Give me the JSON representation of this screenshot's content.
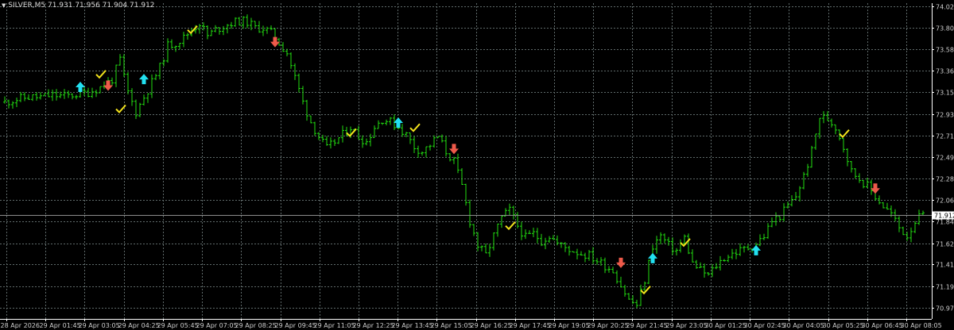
{
  "window": {
    "header_text": "SILVER,M5  71.931 71.956 71.904 71.912",
    "symbol": "SILVER,M5",
    "ohlc": [
      "71.931",
      "71.956",
      "71.904",
      "71.912"
    ]
  },
  "colors": {
    "background": "#000000",
    "grid": "#5f6a6a",
    "candle": "#22dd11",
    "axis": "#ffffff",
    "buy_arrow": "#22e0f0",
    "sell_arrow": "#ee5a4a",
    "check_mark": "#f2e21c",
    "current_price_box": "#ffffff",
    "current_price_line": "#8c8c8c"
  },
  "chart_data": {
    "type": "candlestick",
    "symbol": "SILVER",
    "timeframe": "M5",
    "ylim": [
      70.86,
      74.05
    ],
    "price_ticks": [
      "74.020",
      "73.800",
      "73.585",
      "73.365",
      "73.150",
      "72.930",
      "72.710",
      "72.495",
      "72.280",
      "72.060",
      "71.845",
      "71.625",
      "71.410",
      "71.190",
      "70.975"
    ],
    "current_price": "71.912",
    "time_ticks": [
      "28 Apr 2026",
      "29 Apr 01:45",
      "29 Apr 03:05",
      "29 Apr 04:25",
      "29 Apr 05:45",
      "29 Apr 07:05",
      "29 Apr 08:25",
      "29 Apr 09:45",
      "29 Apr 11:05",
      "29 Apr 12:25",
      "29 Apr 13:45",
      "29 Apr 15:05",
      "29 Apr 16:25",
      "29 Apr 17:45",
      "29 Apr 19:05",
      "29 Apr 20:25",
      "29 Apr 21:45",
      "29 Apr 23:05",
      "30 Apr 01:25",
      "30 Apr 02:45",
      "30 Apr 04:05",
      "30 Apr 05:25",
      "30 Apr 06:45",
      "30 Apr 08:05"
    ],
    "close_path": [
      [
        0,
        73.05
      ],
      [
        3,
        73.08
      ],
      [
        6,
        73.1
      ],
      [
        9,
        73.1
      ],
      [
        12,
        73.12
      ],
      [
        15,
        73.11
      ],
      [
        18,
        73.13
      ],
      [
        21,
        73.15
      ],
      [
        24,
        73.2
      ],
      [
        27,
        73.28
      ],
      [
        29,
        73.48
      ],
      [
        30,
        73.3
      ],
      [
        31,
        73.15
      ],
      [
        33,
        72.95
      ],
      [
        35,
        73.1
      ],
      [
        37,
        73.25
      ],
      [
        39,
        73.4
      ],
      [
        41,
        73.62
      ],
      [
        43,
        73.65
      ],
      [
        45,
        73.7
      ],
      [
        47,
        73.78
      ],
      [
        49,
        73.85
      ],
      [
        51,
        73.72
      ],
      [
        53,
        73.78
      ],
      [
        55,
        73.82
      ],
      [
        57,
        73.85
      ],
      [
        59,
        73.87
      ],
      [
        61,
        73.86
      ],
      [
        63,
        73.8
      ],
      [
        65,
        73.8
      ],
      [
        67,
        73.75
      ],
      [
        69,
        73.65
      ],
      [
        71,
        73.55
      ],
      [
        73,
        73.3
      ],
      [
        75,
        73.05
      ],
      [
        77,
        72.85
      ],
      [
        79,
        72.7
      ],
      [
        81,
        72.58
      ],
      [
        83,
        72.65
      ],
      [
        85,
        72.72
      ],
      [
        87,
        72.8
      ],
      [
        89,
        72.7
      ],
      [
        91,
        72.65
      ],
      [
        93,
        72.8
      ],
      [
        95,
        72.88
      ],
      [
        97,
        72.85
      ],
      [
        99,
        72.8
      ],
      [
        101,
        72.72
      ],
      [
        103,
        72.6
      ],
      [
        105,
        72.55
      ],
      [
        107,
        72.62
      ],
      [
        109,
        72.7
      ],
      [
        111,
        72.55
      ],
      [
        113,
        72.45
      ],
      [
        115,
        72.2
      ],
      [
        117,
        71.85
      ],
      [
        119,
        71.6
      ],
      [
        121,
        71.5
      ],
      [
        123,
        71.7
      ],
      [
        125,
        71.88
      ],
      [
        127,
        71.96
      ],
      [
        129,
        71.8
      ],
      [
        131,
        71.68
      ],
      [
        133,
        71.72
      ],
      [
        135,
        71.65
      ],
      [
        137,
        71.7
      ],
      [
        139,
        71.62
      ],
      [
        141,
        71.58
      ],
      [
        143,
        71.55
      ],
      [
        145,
        71.52
      ],
      [
        147,
        71.5
      ],
      [
        149,
        71.45
      ],
      [
        151,
        71.4
      ],
      [
        153,
        71.35
      ],
      [
        155,
        71.2
      ],
      [
        157,
        71.05
      ],
      [
        159,
        71.0
      ],
      [
        161,
        71.25
      ],
      [
        163,
        71.6
      ],
      [
        165,
        71.7
      ],
      [
        167,
        71.6
      ],
      [
        169,
        71.55
      ],
      [
        171,
        71.68
      ],
      [
        173,
        71.42
      ],
      [
        175,
        71.35
      ],
      [
        177,
        71.3
      ],
      [
        179,
        71.4
      ],
      [
        181,
        71.48
      ],
      [
        183,
        71.52
      ],
      [
        185,
        71.55
      ],
      [
        187,
        71.58
      ],
      [
        189,
        71.62
      ],
      [
        191,
        71.7
      ],
      [
        193,
        71.85
      ],
      [
        195,
        71.9
      ],
      [
        197,
        72.0
      ],
      [
        199,
        72.1
      ],
      [
        201,
        72.3
      ],
      [
        203,
        72.55
      ],
      [
        205,
        72.9
      ],
      [
        207,
        72.88
      ],
      [
        209,
        72.8
      ],
      [
        211,
        72.6
      ],
      [
        213,
        72.35
      ],
      [
        215,
        72.28
      ],
      [
        217,
        72.2
      ],
      [
        219,
        72.1
      ],
      [
        221,
        72.0
      ],
      [
        223,
        71.92
      ],
      [
        225,
        71.78
      ],
      [
        227,
        71.7
      ],
      [
        229,
        71.85
      ],
      [
        231,
        71.91
      ]
    ],
    "signals": [
      {
        "type": "buy_arrow",
        "bar": 19,
        "price": 73.2
      },
      {
        "type": "check",
        "bar": 24,
        "price": 73.33
      },
      {
        "type": "sell_arrow",
        "bar": 26,
        "price": 73.22
      },
      {
        "type": "check",
        "bar": 29,
        "price": 72.98
      },
      {
        "type": "buy_arrow",
        "bar": 35,
        "price": 73.28
      },
      {
        "type": "check",
        "bar": 47,
        "price": 73.78
      },
      {
        "type": "sell_arrow",
        "bar": 68,
        "price": 73.66
      },
      {
        "type": "check",
        "bar": 87,
        "price": 72.74
      },
      {
        "type": "buy_arrow",
        "bar": 99,
        "price": 72.84
      },
      {
        "type": "check",
        "bar": 103,
        "price": 72.79
      },
      {
        "type": "sell_arrow",
        "bar": 113,
        "price": 72.58
      },
      {
        "type": "check",
        "bar": 127,
        "price": 71.8
      },
      {
        "type": "sell_arrow",
        "bar": 155,
        "price": 71.43
      },
      {
        "type": "check",
        "bar": 161,
        "price": 71.15
      },
      {
        "type": "buy_arrow",
        "bar": 163,
        "price": 71.47
      },
      {
        "type": "check",
        "bar": 171,
        "price": 71.63
      },
      {
        "type": "buy_arrow",
        "bar": 189,
        "price": 71.55
      },
      {
        "type": "check",
        "bar": 211,
        "price": 72.73
      },
      {
        "type": "sell_arrow",
        "bar": 219,
        "price": 72.18
      }
    ]
  }
}
